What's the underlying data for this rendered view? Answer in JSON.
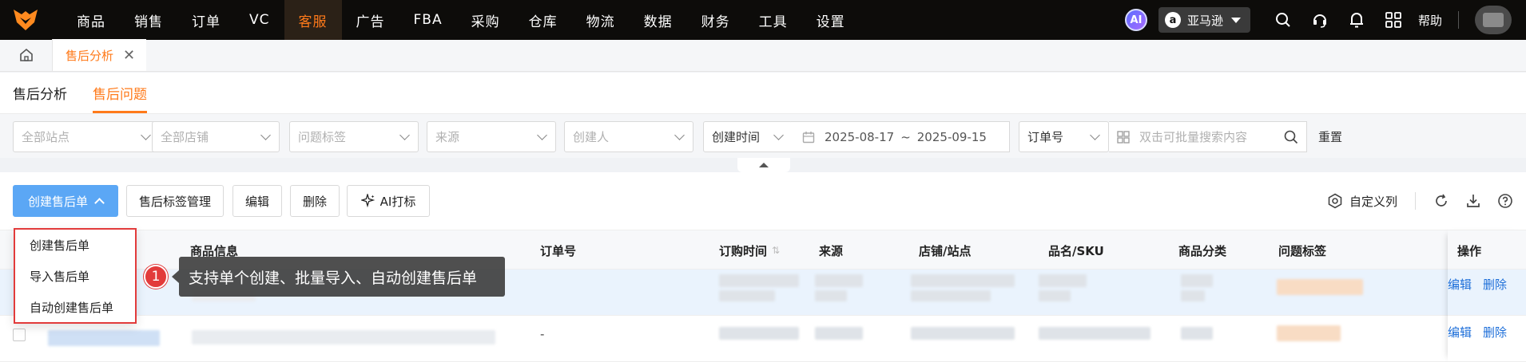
{
  "topnav": {
    "items": [
      "商品",
      "销售",
      "订单",
      "VC",
      "客服",
      "广告",
      "FBA",
      "采购",
      "仓库",
      "物流",
      "数据",
      "财务",
      "工具",
      "设置"
    ],
    "active": "客服",
    "ai_label": "AI",
    "marketplace": "亚马逊",
    "marketplace_icon": "a",
    "help": "帮助",
    "colors": {
      "accent": "#ff7a1a",
      "nav_bg": "#0d0c0a"
    }
  },
  "tabstrip": {
    "page_tab": "售后分析",
    "close": "✕"
  },
  "subtabs": [
    {
      "label": "售后分析",
      "active": false
    },
    {
      "label": "售后问题",
      "active": true
    }
  ],
  "filters": {
    "site": "全部站点",
    "shop": "全部店铺",
    "tag": "问题标签",
    "source": "来源",
    "creator": "创建人",
    "time_type": "创建时间",
    "date_start": "2025-08-17",
    "date_sep": "~",
    "date_end": "2025-09-15",
    "order_type": "订单号",
    "search_placeholder": "双击可批量搜索内容",
    "reset": "重置"
  },
  "toolbar": {
    "create": "创建售后单",
    "tag_manage": "售后标签管理",
    "edit": "编辑",
    "delete": "删除",
    "ai_tag": "AI打标",
    "custom_columns": "自定义列"
  },
  "create_menu": [
    "创建售后单",
    "导入售后单",
    "自动创建售后单"
  ],
  "table": {
    "headers": [
      "商品信息",
      "订单号",
      "订购时间",
      "来源",
      "店铺/站点",
      "品名/SKU",
      "商品分类",
      "问题标签",
      "操作"
    ],
    "row_actions": {
      "edit": "编辑",
      "delete": "删除"
    },
    "row2_order": "-"
  },
  "callout": {
    "number": "1",
    "text": "支持单个创建、批量导入、自动创建售后单"
  }
}
